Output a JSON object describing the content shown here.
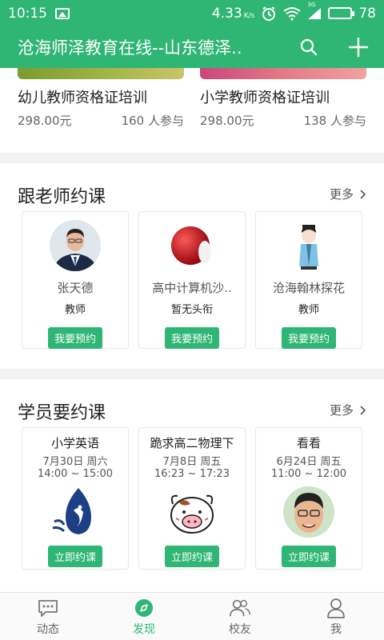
{
  "status_bar": {
    "time": "10:15",
    "network_speed": "4.33",
    "network_speed_unit": "K/s",
    "battery": "78",
    "network_type": "3G"
  },
  "app_bar": {
    "title": "沧海师泽教育在线--山东德泽..",
    "search_icon": "search-icon",
    "add_icon": "plus-icon"
  },
  "courses": [
    {
      "title": "幼儿教师资格证培训",
      "price": "298.00元",
      "participants": "160 人参与"
    },
    {
      "title": "小学教师资格证培训",
      "price": "298.00元",
      "participants": "138 人参与"
    }
  ],
  "teacher_section": {
    "title": "跟老师约课",
    "more": "更多",
    "cards": [
      {
        "name": "张天德",
        "role": "教师",
        "button": "我要预约"
      },
      {
        "name": "高中计算机沙..",
        "role": "暂无头衔",
        "button": "我要预约"
      },
      {
        "name": "沧海翰林探花",
        "role": "教师",
        "button": "我要预约"
      }
    ]
  },
  "student_section": {
    "title": "学员要约课",
    "more": "更多",
    "cards": [
      {
        "course": "小学英语",
        "date": "7月30日 周六",
        "time": "14:00 ~ 15:00",
        "button": "立即约课"
      },
      {
        "course": "跪求高二物理下",
        "date": "7月8日 周五",
        "time": "16:23 ~ 17:23",
        "button": "立即约课"
      },
      {
        "course": "看看",
        "date": "6月24日 周五",
        "time": "11:00 ~ 12:00",
        "button": "立即约课"
      }
    ]
  },
  "tabs": [
    {
      "label": "动态",
      "icon": "chat-bubble-icon",
      "active": false
    },
    {
      "label": "发现",
      "icon": "compass-icon",
      "active": true
    },
    {
      "label": "校友",
      "icon": "people-icon",
      "active": false
    },
    {
      "label": "我",
      "icon": "person-icon",
      "active": false
    }
  ],
  "colors": {
    "brand": "#2fb574",
    "text": "#222222",
    "muted": "#666666"
  }
}
